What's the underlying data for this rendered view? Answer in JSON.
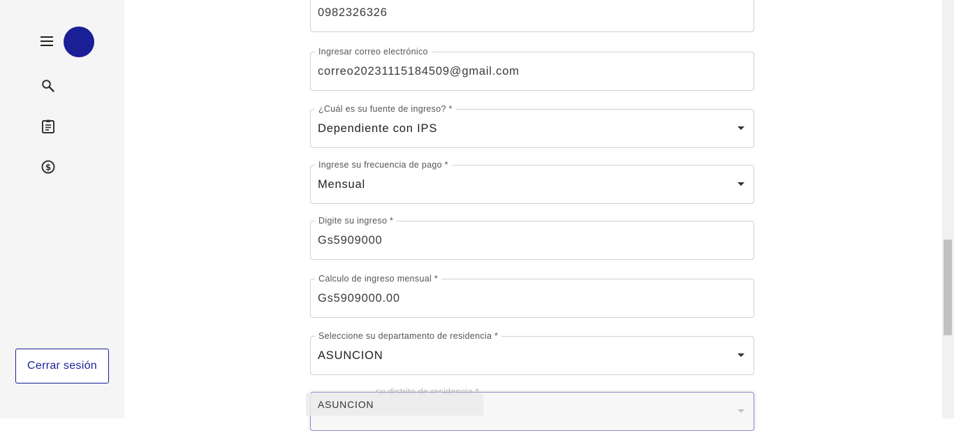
{
  "sidebar": {
    "menu_icon": "hamburger-menu-icon",
    "avatar_color": "#1a1f96",
    "nav_icons": [
      "search-icon",
      "clipboard-icon",
      "dollar-icon"
    ],
    "logout_label": "Cerrar sesión"
  },
  "form": {
    "phone_value": "0982326326",
    "email": {
      "label": "Ingresar correo electrónico",
      "value": "correo20231115184509@gmail.com"
    },
    "income_source": {
      "label": "¿Cuál es su fuente de ingreso? *",
      "value": "Dependiente con IPS"
    },
    "pay_frequency": {
      "label": "Ingrese su frecuencia de pago *",
      "value": "Mensual"
    },
    "income": {
      "label": "Digite su ingreso *",
      "value": "Gs5909000"
    },
    "monthly_income": {
      "label": "Calculo de ingreso mensual *",
      "value": "Gs5909000.00"
    },
    "department": {
      "label": "Seleccione su departamento de residencia *",
      "value": "ASUNCION"
    },
    "district": {
      "label": "su distrito de residencia *",
      "dragged_option": "ASUNCION"
    }
  },
  "colors": {
    "accent": "#1a1f96",
    "border": "#d0d0d0",
    "sidebar_bg": "#f5f5f5"
  }
}
